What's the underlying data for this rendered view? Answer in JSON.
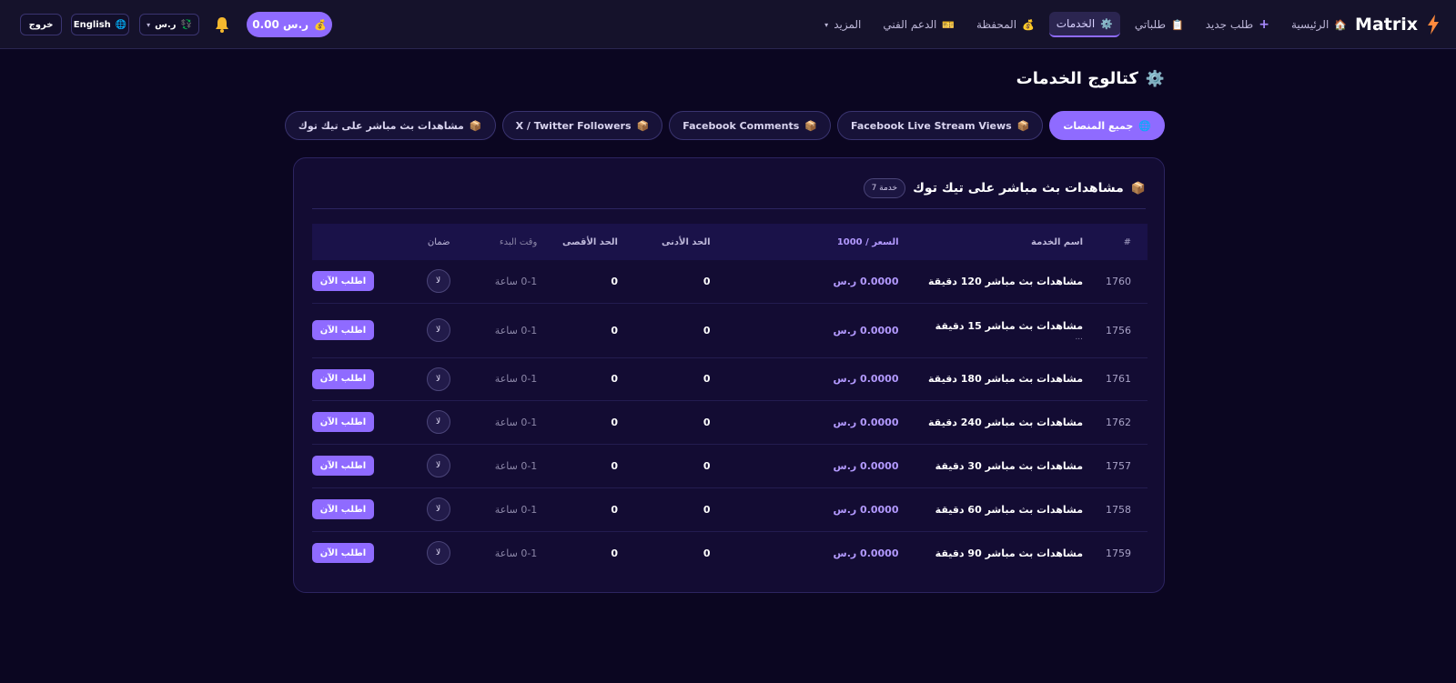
{
  "brand": {
    "name": "Matrix"
  },
  "nav": {
    "items": [
      {
        "icon": "🏠",
        "label": "الرئيسية"
      },
      {
        "icon": "➕",
        "label": "طلب جديد"
      },
      {
        "icon": "📋",
        "label": "طلباتي"
      },
      {
        "icon": "⚙️",
        "label": "الخدمات",
        "active": true
      },
      {
        "icon": "💰",
        "label": "المحفظة"
      },
      {
        "icon": "🎫",
        "label": "الدعم الفني"
      },
      {
        "icon": "",
        "label": "المزيد",
        "caret": "▾"
      }
    ]
  },
  "header": {
    "balance_icon": "💰",
    "balance": "0.00 ر.س",
    "currency": "ر.س",
    "currency_caret": "▾",
    "currency_icon": "💱",
    "language": "English",
    "language_icon": "🌐",
    "logout": "خروج"
  },
  "page": {
    "title_icon": "⚙️",
    "title": "كتالوج الخدمات"
  },
  "tabs": [
    {
      "icon": "🌐",
      "label": "جميع المنصات",
      "active": true
    },
    {
      "icon": "📦",
      "label": "Facebook Live Stream Views"
    },
    {
      "icon": "📦",
      "label": "Facebook Comments"
    },
    {
      "icon": "📦",
      "label": "X / Twitter Followers"
    },
    {
      "icon": "📦",
      "label": "مشاهدات بث مباشر على تيك توك"
    }
  ],
  "card": {
    "title_icon": "📦",
    "title": "مشاهدات بث مباشر على تيك توك",
    "count_badge": "7 خدمة"
  },
  "table": {
    "headers": {
      "id": "#",
      "name": "اسم الخدمة",
      "price": "السعر / 1000",
      "min": "الحد الأدنى",
      "max": "الحد الأقصى",
      "start": "وقت البدء",
      "guarantee": "ضمان"
    },
    "rows": [
      {
        "id": "1760",
        "name": "مشاهدات بث مباشر 120 دقيقة",
        "sub": "",
        "price": "0.0000 ر.س",
        "min": "0",
        "max": "0",
        "start": "0-1 ساعة",
        "guarantee": "لا",
        "action": "اطلب الآن"
      },
      {
        "id": "1756",
        "name": "مشاهدات بث مباشر 15 دقيقة",
        "sub": "...",
        "price": "0.0000 ر.س",
        "min": "0",
        "max": "0",
        "start": "0-1 ساعة",
        "guarantee": "لا",
        "action": "اطلب الآن"
      },
      {
        "id": "1761",
        "name": "مشاهدات بث مباشر 180 دقيقة",
        "sub": "",
        "price": "0.0000 ر.س",
        "min": "0",
        "max": "0",
        "start": "0-1 ساعة",
        "guarantee": "لا",
        "action": "اطلب الآن"
      },
      {
        "id": "1762",
        "name": "مشاهدات بث مباشر 240 دقيقة",
        "sub": "",
        "price": "0.0000 ر.س",
        "min": "0",
        "max": "0",
        "start": "0-1 ساعة",
        "guarantee": "لا",
        "action": "اطلب الآن"
      },
      {
        "id": "1757",
        "name": "مشاهدات بث مباشر 30 دقيقة",
        "sub": "",
        "price": "0.0000 ر.س",
        "min": "0",
        "max": "0",
        "start": "0-1 ساعة",
        "guarantee": "لا",
        "action": "اطلب الآن"
      },
      {
        "id": "1758",
        "name": "مشاهدات بث مباشر 60 دقيقة",
        "sub": "",
        "price": "0.0000 ر.س",
        "min": "0",
        "max": "0",
        "start": "0-1 ساعة",
        "guarantee": "لا",
        "action": "اطلب الآن"
      },
      {
        "id": "1759",
        "name": "مشاهدات بث مباشر 90 دقيقة",
        "sub": "",
        "price": "0.0000 ر.س",
        "min": "0",
        "max": "0",
        "start": "0-1 ساعة",
        "guarantee": "لا",
        "action": "اطلب الآن"
      }
    ]
  },
  "colors": {
    "accent": "#8f6bff",
    "background": "#0b0621",
    "card": "#130c33",
    "topbar": "#15122b"
  }
}
